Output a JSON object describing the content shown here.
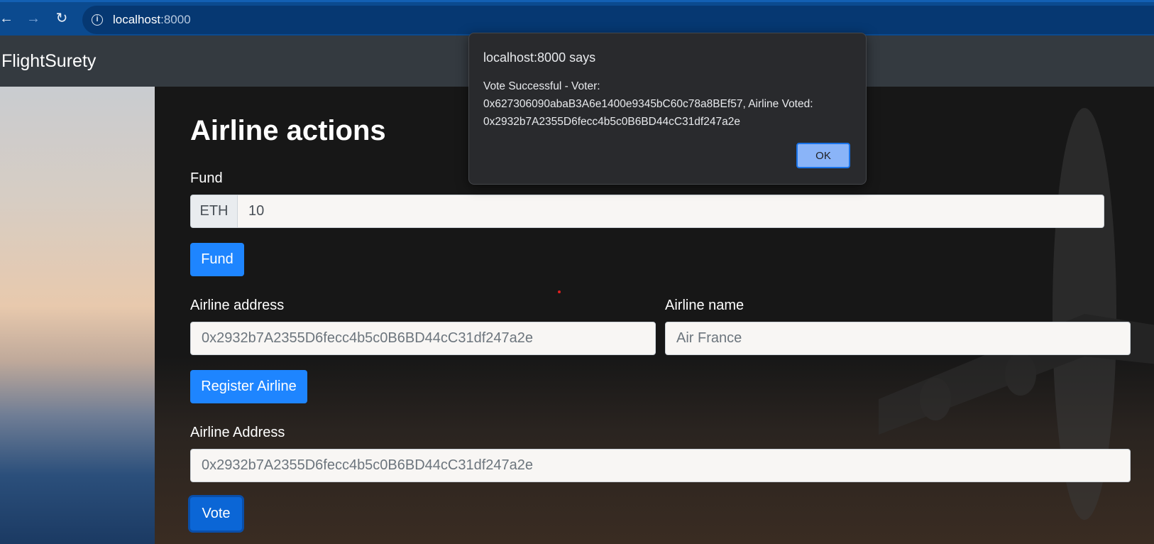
{
  "browser": {
    "back_icon": "←",
    "forward_icon": "→",
    "reload_icon": "↻",
    "info_icon": "i",
    "url_host": "localhost",
    "url_port": ":8000"
  },
  "navbar": {
    "brand": "FlightSurety"
  },
  "main": {
    "heading": "Airline actions",
    "fund": {
      "label": "Fund",
      "addon": "ETH",
      "value": "10",
      "button": "Fund"
    },
    "register": {
      "address_label": "Airline address",
      "address_placeholder": "0x2932b7A2355D6fecc4b5c0B6BD44cC31df247a2e",
      "name_label": "Airline name",
      "name_placeholder": "Air France",
      "button": "Register Airline"
    },
    "vote": {
      "address_label": "Airline Address",
      "address_placeholder": "0x2932b7A2355D6fecc4b5c0B6BD44cC31df247a2e",
      "button": "Vote"
    }
  },
  "dialog": {
    "title": "localhost:8000 says",
    "message_line1": "Vote Successful - Voter:",
    "message_line2": "0x627306090abaB3A6e1400e9345bC60c78a8BEf57, Airline Voted:",
    "message_line3": "0x2932b7A2355D6fecc4b5c0B6BD44cC31df247a2e",
    "ok_label": "OK"
  },
  "colors": {
    "primary": "#1e85ff",
    "navbar": "#343a40",
    "dialog_bg": "#292a2d",
    "dialog_ok": "#8ab4f8"
  }
}
